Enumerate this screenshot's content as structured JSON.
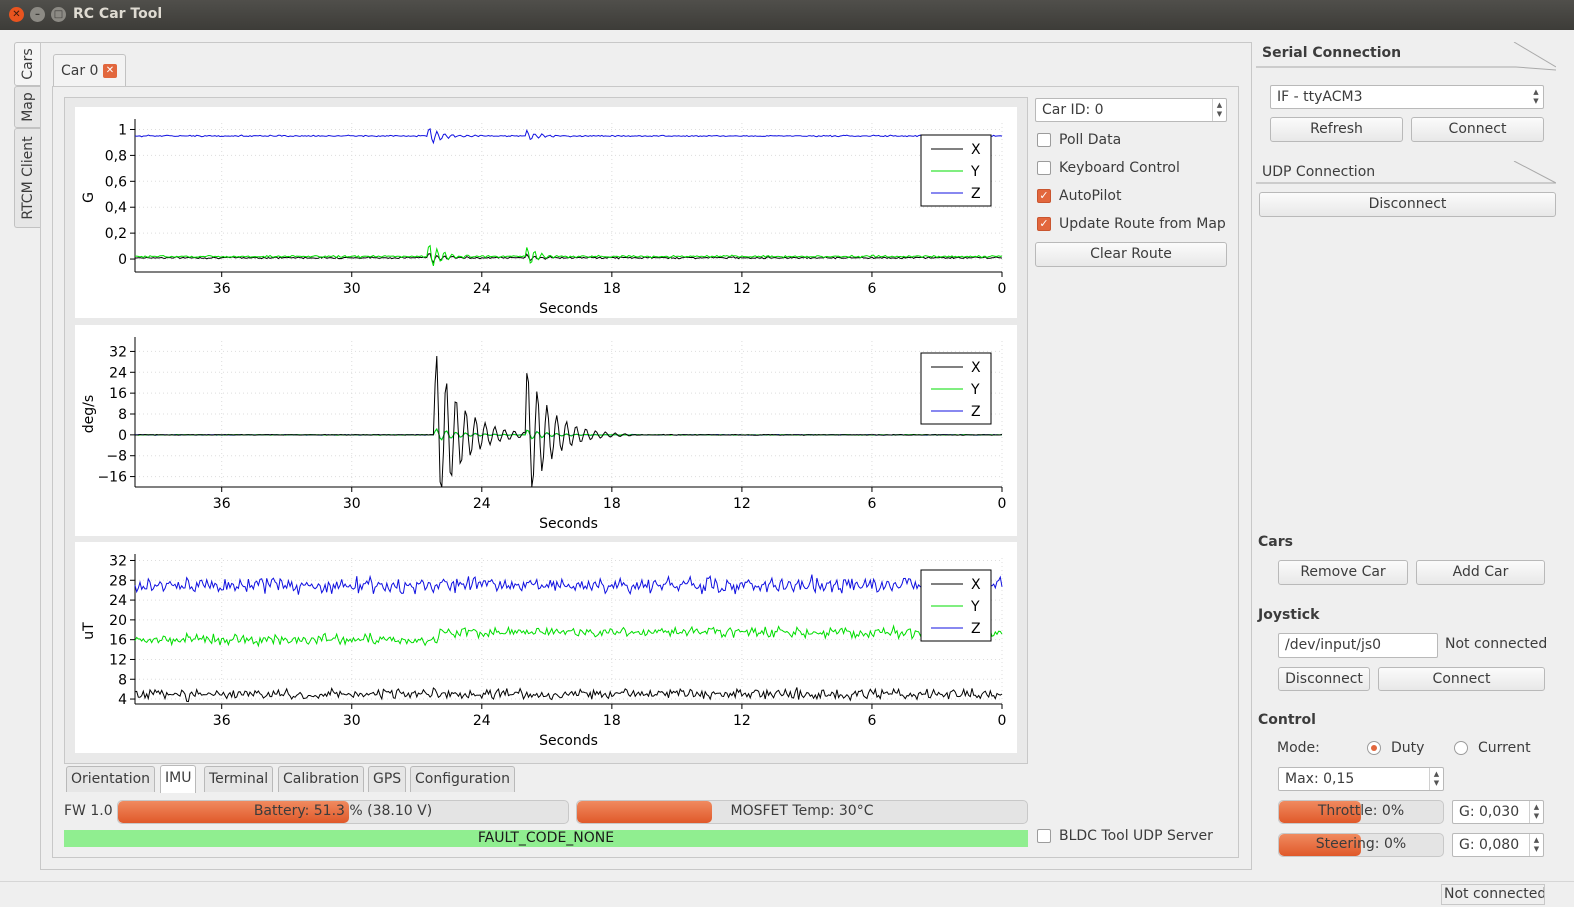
{
  "window": {
    "title": "RC Car Tool"
  },
  "side_tabs": [
    "Cars",
    "Map",
    "RTCM Client"
  ],
  "car_tab": {
    "label": "Car 0",
    "close": "✕"
  },
  "car_id": "Car ID: 0",
  "checkboxes": {
    "poll_data": {
      "label": "Poll Data",
      "checked": false
    },
    "keyboard_control": {
      "label": "Keyboard Control",
      "checked": false
    },
    "autopilot": {
      "label": "AutoPilot",
      "checked": true
    },
    "update_route": {
      "label": "Update Route from Map",
      "checked": true
    },
    "bldc_udp": {
      "label": "BLDC Tool UDP Server",
      "checked": false
    }
  },
  "clear_route": "Clear Route",
  "bottom_tabs": [
    "Orientation",
    "IMU",
    "Terminal",
    "Calibration",
    "GPS",
    "Configuration"
  ],
  "active_bottom_tab": "IMU",
  "status": {
    "fw": "FW 1.0",
    "battery": "Battery: 51.3 % (38.10 V)",
    "battery_level": 0.513,
    "mosfet": "MOSFET Temp: 30°C",
    "mosfet_level": 0.3,
    "fault": "FAULT_CODE_NONE"
  },
  "serial": {
    "title": "Serial Connection",
    "port": "IF - ttyACM3",
    "refresh": "Refresh",
    "connect": "Connect"
  },
  "udp": {
    "title": "UDP Connection",
    "disconnect": "Disconnect"
  },
  "cars": {
    "title": "Cars",
    "remove": "Remove Car",
    "add": "Add Car"
  },
  "joystick": {
    "title": "Joystick",
    "device": "/dev/input/js0",
    "status": "Not connected",
    "disconnect": "Disconnect",
    "connect": "Connect"
  },
  "control": {
    "title": "Control",
    "mode_label": "Mode:",
    "duty": "Duty",
    "current": "Current",
    "max": "Max: 0,15",
    "throttle": "Throttle: 0%",
    "throttle_level": 0.5,
    "throttle_gain": "G: 0,030",
    "steering": "Steering: 0%",
    "steering_level": 0.5,
    "steering_gain": "G: 0,080"
  },
  "statusbar": "Not connected",
  "colors": {
    "x": "#000000",
    "y": "#00dd00",
    "z": "#1010e0",
    "accent": "#e2673d",
    "fault_ok": "#90ee90"
  },
  "chart_data": [
    {
      "type": "line",
      "ylabel": "G",
      "xlabel": "Seconds",
      "xlim": [
        40,
        0
      ],
      "x_ticks": [
        "36",
        "30",
        "24",
        "18",
        "12",
        "6",
        "0"
      ],
      "y_ticks": [
        "1",
        "0,8",
        "0,6",
        "0,4",
        "0,2",
        "0"
      ],
      "ylim": [
        -0.1,
        1.05
      ],
      "series": [
        {
          "name": "X",
          "baseline": 0.01,
          "noise": 0.005
        },
        {
          "name": "Y",
          "baseline": 0.02,
          "noise": 0.006
        },
        {
          "name": "Z",
          "baseline": 0.95,
          "noise": 0.004
        }
      ],
      "legend": "top-right"
    },
    {
      "type": "line",
      "ylabel": "deg/s",
      "xlabel": "Seconds",
      "xlim": [
        40,
        0
      ],
      "x_ticks": [
        "36",
        "30",
        "24",
        "18",
        "12",
        "6",
        "0"
      ],
      "y_ticks": [
        "32",
        "24",
        "16",
        "8",
        "0",
        "−8",
        "−16"
      ],
      "ylim": [
        -20,
        36
      ],
      "series": [
        {
          "name": "X",
          "baseline": 0,
          "noise": 0.1
        },
        {
          "name": "Y",
          "baseline": 0,
          "noise": 0.1
        },
        {
          "name": "Z",
          "baseline": 0,
          "noise": 0.1
        }
      ],
      "legend": "top-right"
    },
    {
      "type": "line",
      "ylabel": "uT",
      "xlabel": "Seconds",
      "xlim": [
        40,
        0
      ],
      "x_ticks": [
        "36",
        "30",
        "24",
        "18",
        "12",
        "6",
        "0"
      ],
      "y_ticks": [
        "32",
        "28",
        "24",
        "20",
        "16",
        "12",
        "8",
        "4"
      ],
      "ylim": [
        3,
        32.5
      ],
      "series": [
        {
          "name": "X",
          "baseline": 5,
          "noise": 0.8
        },
        {
          "name": "Y",
          "baseline": 16,
          "noise": 0.8
        },
        {
          "name": "Z",
          "baseline": 27,
          "noise": 1.2
        }
      ],
      "legend": "top-right"
    }
  ]
}
